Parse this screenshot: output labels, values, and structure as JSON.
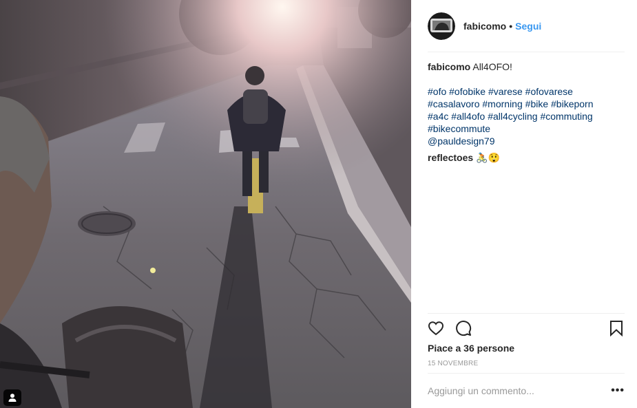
{
  "post": {
    "username": "fabicomo",
    "separator": "•",
    "follow_label": "Segui",
    "caption": {
      "author": "fabicomo",
      "text": "All4OFO!",
      "hashtags": [
        "#ofo",
        "#ofobike",
        "#varese",
        "#ofovarese",
        "#casalavoro",
        "#morning",
        "#bike",
        "#bikeporn",
        "#a4c",
        "#all4ofo",
        "#all4cycling",
        "#commuting",
        "#bikecommute",
        "@pauldesign79"
      ]
    },
    "comment": {
      "author": "reflectoes",
      "text": "🚴😲"
    },
    "likes_label": "Piace a 36 persone",
    "date_label": "15 NOVEMBRE",
    "comment_placeholder": "Aggiungi un commento...",
    "more_label": "•••"
  },
  "icons": {
    "like": "heart-outline-icon",
    "comment": "speech-bubble-icon",
    "save": "bookmark-icon",
    "tagged_users": "person-icon"
  },
  "colors": {
    "link": "#3897f0",
    "hashtag": "#003569",
    "divider": "#efefef",
    "muted": "#999999"
  }
}
